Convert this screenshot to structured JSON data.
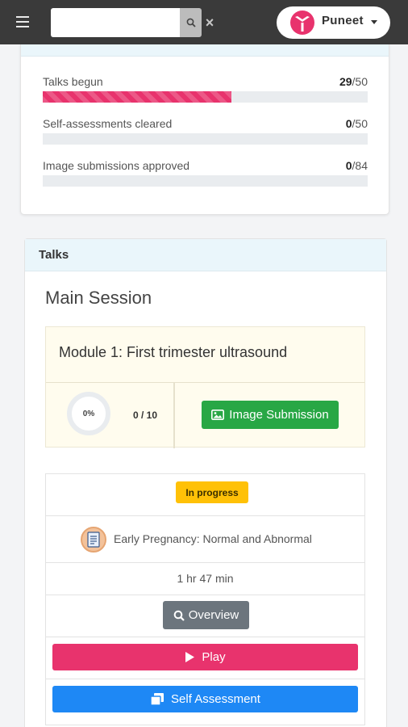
{
  "navbar": {
    "menu_icon": "hamburger-icon",
    "search": {
      "value": "",
      "placeholder": ""
    },
    "search_icon": "search-icon",
    "clear_icon": "close-icon",
    "clear_glyph": "×",
    "user": {
      "name": "Puneet",
      "logo_icon": "brand-logo-icon",
      "caret_icon": "caret-down-icon"
    }
  },
  "progress": {
    "items": [
      {
        "label": "Talks begun",
        "done": "29",
        "total": "/50",
        "fraction": 0.58
      },
      {
        "label": "Self-assessments cleared",
        "done": "0",
        "total": "/50",
        "fraction": 0
      },
      {
        "label": "Image submissions approved",
        "done": "0",
        "total": "/84",
        "fraction": 0
      }
    ]
  },
  "talks": {
    "header": "Talks",
    "session_title": "Main Session",
    "module": {
      "title": "Module 1: First trimester ultrasound",
      "percent": "0%",
      "count": "0 / 10",
      "image_submission_label": "Image Submission",
      "image_icon": "image-icon"
    },
    "talk": {
      "status": "In progress",
      "name": "Early Pregnancy: Normal and Abnormal",
      "icon": "document-icon",
      "duration": "1 hr 47 min",
      "overview_label": "Overview",
      "play_label": "Play",
      "self_assessment_label": "Self Assessment"
    }
  },
  "colors": {
    "navbar": "#3a3a3a",
    "accent_pink": "#e8336d",
    "success_green": "#28a745",
    "warning_yellow": "#ffc107",
    "primary_blue": "#1e88f5",
    "secondary_gray": "#6c757d",
    "card_header": "#eaf6fb"
  }
}
